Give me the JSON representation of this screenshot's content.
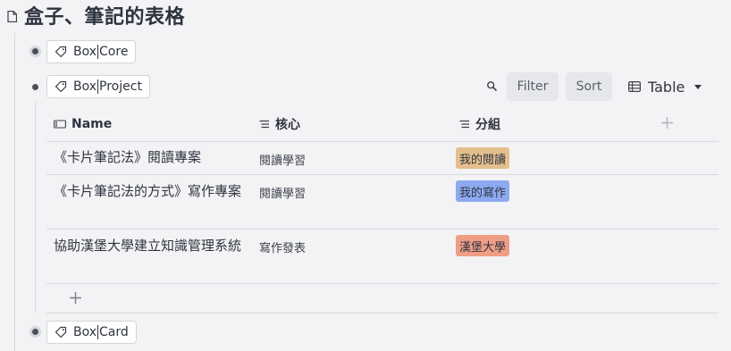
{
  "page": {
    "title": "盒子、筆記的表格"
  },
  "blocks": [
    {
      "tag": "Box",
      "sub": "Core"
    },
    {
      "tag": "Box",
      "sub": "Project"
    },
    {
      "tag": "Box",
      "sub": "Card"
    }
  ],
  "toolbar": {
    "filter": "Filter",
    "sort": "Sort",
    "view": "Table"
  },
  "table": {
    "columns": [
      "Name",
      "核心",
      "分組"
    ],
    "rows": [
      {
        "name": "《卡片筆記法》閱讀專案",
        "core": "閱讀學習",
        "group": "我的閱讀"
      },
      {
        "name": "《卡片筆記法的方式》寫作專案",
        "core": "閱讀學習",
        "group": "我的寫作"
      },
      {
        "name": "協助漢堡大學建立知識管理系統",
        "core": "寫作發表",
        "group": "漢堡大學"
      }
    ]
  },
  "colors": {
    "badge_reading": "#e4bf8c",
    "badge_writing": "#8da9f0",
    "badge_hamburg": "#ef9e86"
  }
}
